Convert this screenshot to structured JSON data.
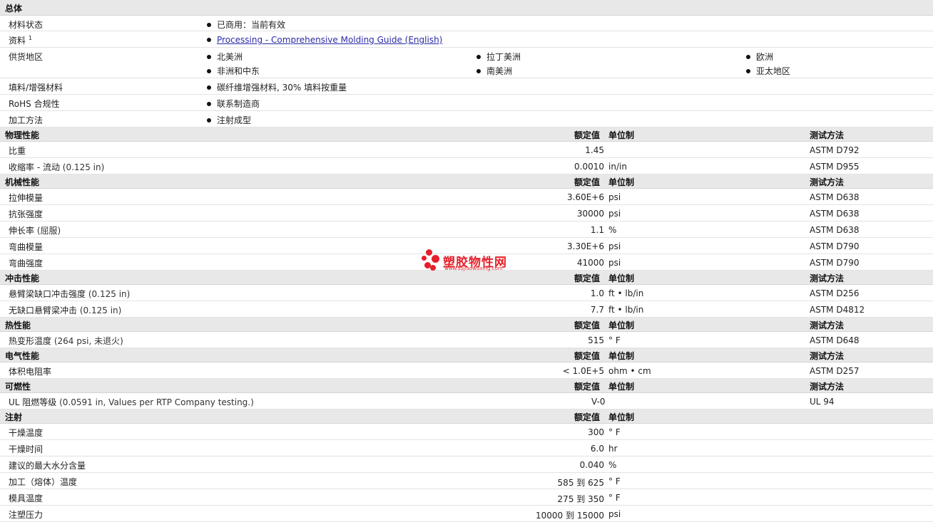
{
  "general": {
    "title": "总体",
    "status_label": "材料状态",
    "status_value": "已商用：当前有效",
    "docs_label": "资料",
    "docs_sup": "1",
    "docs_link": "Processing - Comprehensive Molding Guide (English)",
    "regions_label": "供货地区",
    "regions": [
      "北美洲",
      "拉丁美洲",
      "欧洲",
      "非洲和中东",
      "南美洲",
      "亚太地区"
    ],
    "filler_label": "填料/增强材料",
    "filler_value": "碳纤维增强材料, 30% 填料按重量",
    "rohs_label": "RoHS 合规性",
    "rohs_value": "联系制造商",
    "process_label": "加工方法",
    "process_value": "注射成型"
  },
  "headers": {
    "value": "额定值",
    "unit": "单位制",
    "test": "测试方法"
  },
  "sections": [
    {
      "title": "物理性能",
      "has_test": true,
      "rows": [
        {
          "name": "比重",
          "value": "1.45",
          "unit": "",
          "test": "ASTM D792"
        },
        {
          "name": "收缩率 - 流动",
          "cond": "(0.125 in)",
          "value": "0.0010",
          "unit": "in/in",
          "test": "ASTM D955"
        }
      ]
    },
    {
      "title": "机械性能",
      "has_test": true,
      "rows": [
        {
          "name": "拉伸模量",
          "value": "3.60E+6",
          "unit": "psi",
          "test": "ASTM D638"
        },
        {
          "name": "抗张强度",
          "value": "30000",
          "unit": "psi",
          "test": "ASTM D638"
        },
        {
          "name": "伸长率",
          "cond": "(屈服)",
          "value": "1.1",
          "unit": "%",
          "test": "ASTM D638"
        },
        {
          "name": "弯曲模量",
          "value": "3.30E+6",
          "unit": "psi",
          "test": "ASTM D790"
        },
        {
          "name": "弯曲强度",
          "value": "41000",
          "unit": "psi",
          "test": "ASTM D790"
        }
      ]
    },
    {
      "title": "冲击性能",
      "has_test": true,
      "rows": [
        {
          "name": "悬臂梁缺口冲击强度",
          "cond": "(0.125 in)",
          "value": "1.0",
          "unit": "ft • lb/in",
          "test": "ASTM D256"
        },
        {
          "name": "无缺口悬臂梁冲击",
          "cond": "(0.125 in)",
          "value": "7.7",
          "unit": "ft • lb/in",
          "test": "ASTM D4812"
        }
      ]
    },
    {
      "title": "热性能",
      "has_test": true,
      "rows": [
        {
          "name": "热变形温度",
          "cond": "(264 psi, 未退火)",
          "value": "515",
          "unit": "° F",
          "test": "ASTM D648"
        }
      ]
    },
    {
      "title": "电气性能",
      "has_test": true,
      "rows": [
        {
          "name": "体积电阻率",
          "value": "< 1.0E+5",
          "unit": "ohm • cm",
          "test": "ASTM D257"
        }
      ]
    },
    {
      "title": "可燃性",
      "has_test": true,
      "rows": [
        {
          "name": "UL 阻燃等级",
          "cond": "(0.0591 in, Values per RTP Company testing.)",
          "value": "V-0",
          "unit": "",
          "test": "UL 94",
          "ul": true
        }
      ]
    },
    {
      "title": "注射",
      "has_test": false,
      "rows": [
        {
          "name": "干燥温度",
          "value": "300",
          "unit": "° F",
          "test": ""
        },
        {
          "name": "干燥时间",
          "value": "6.0",
          "unit": "hr",
          "test": ""
        },
        {
          "name": "建议的最大水分含量",
          "value": "0.040",
          "unit": "%",
          "test": ""
        },
        {
          "name": "加工（熔体）温度",
          "value": "585 到  625",
          "unit": "° F",
          "test": ""
        },
        {
          "name": "模具温度",
          "value": "275 到  350",
          "unit": "° F",
          "test": ""
        },
        {
          "name": "注塑压力",
          "value": "10000 到  15000",
          "unit": "psi",
          "test": ""
        }
      ]
    }
  ],
  "watermark": {
    "title": "塑胶物性网",
    "url": "www.sujiaowuxing.com",
    "color": "#e5202a"
  }
}
